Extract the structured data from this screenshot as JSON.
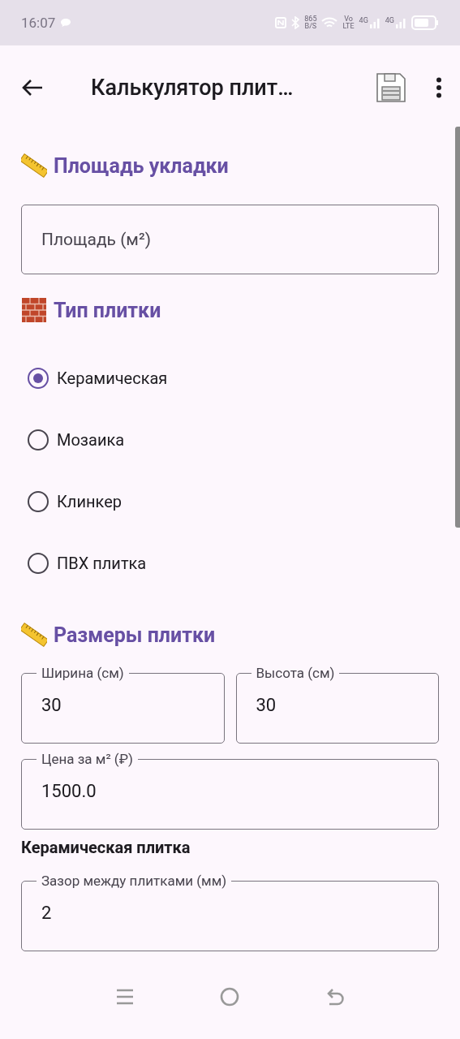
{
  "status_bar": {
    "time": "16:07",
    "speed": [
      "865",
      "B/S"
    ],
    "volte": [
      "Vo",
      "LTE"
    ],
    "networks": [
      "4G",
      "4G"
    ]
  },
  "app_bar": {
    "title": "Калькулятор плит…"
  },
  "sections": [
    {
      "kind": "field",
      "title": "Площадь укладки",
      "fields": [
        {
          "placeholder": "Площадь (м²)"
        }
      ]
    },
    {
      "kind": "radio",
      "title": "Тип плитки",
      "options": [
        {
          "label": "Керамическая",
          "selected": true
        },
        {
          "label": "Мозаика",
          "selected": false
        },
        {
          "label": "Клинкер",
          "selected": false
        },
        {
          "label": "ПВХ плитка",
          "selected": false
        }
      ]
    },
    {
      "kind": "fields",
      "title": "Размеры плитки",
      "rows": [
        [
          {
            "label": "Ширина (см)",
            "value": "30"
          },
          {
            "label": "Высота (см)",
            "value": "30"
          }
        ],
        [
          {
            "label": "Цена за м² (₽)",
            "value": "1500.0"
          }
        ]
      ]
    },
    {
      "kind": "plain",
      "title": "Керамическая плитка",
      "rows": [
        [
          {
            "label": "Зазор между плитками (мм)",
            "value": "2"
          }
        ]
      ]
    }
  ]
}
